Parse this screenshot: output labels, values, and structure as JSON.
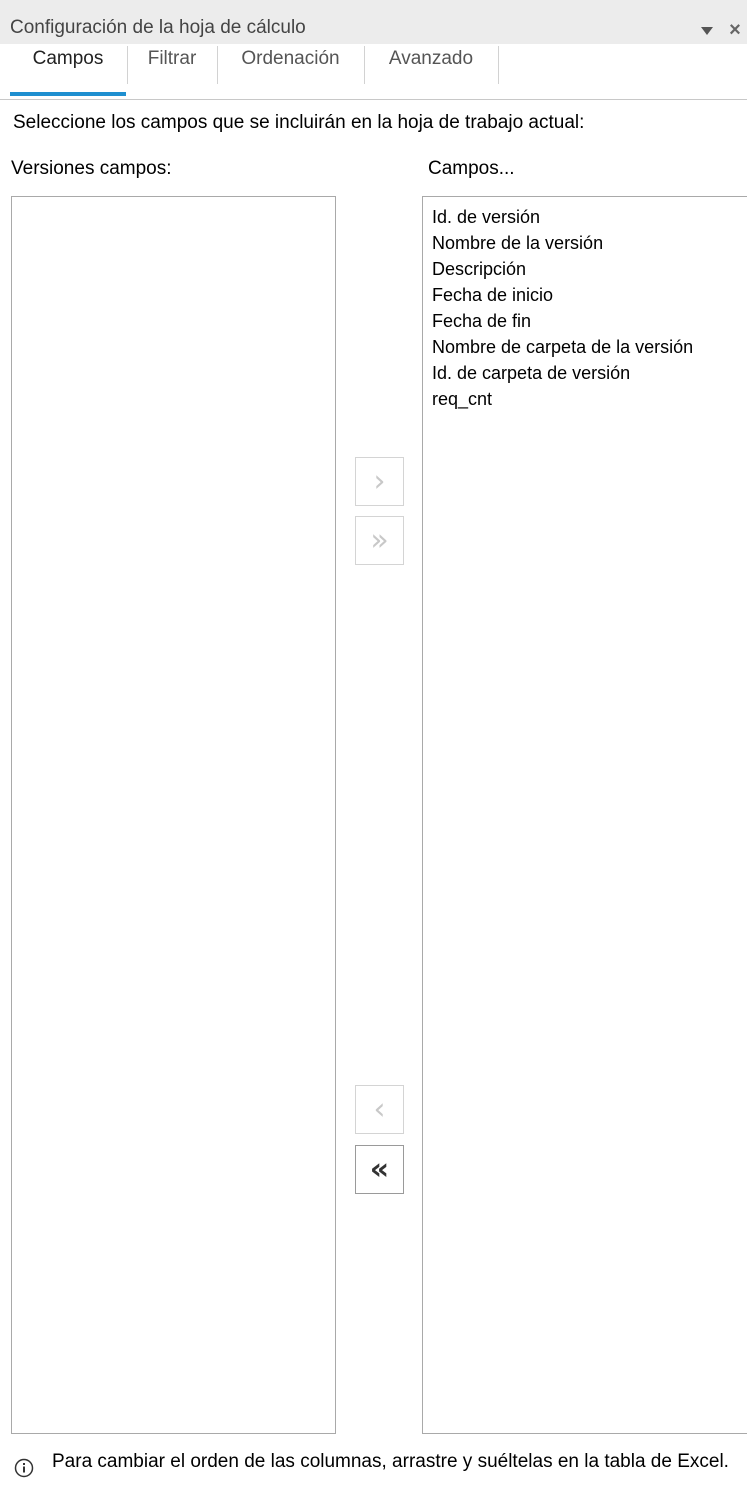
{
  "pane": {
    "title": "Configuración de la hoja de cálculo",
    "menu_icon": "dropdown-arrow-icon",
    "close_icon": "close-icon",
    "close_glyph": "×"
  },
  "tabs": [
    {
      "label": "Campos",
      "active": true
    },
    {
      "label": "Filtrar",
      "active": false
    },
    {
      "label": "Ordenación",
      "active": false
    },
    {
      "label": "Avanzado",
      "active": false
    }
  ],
  "instruction": "Seleccione los campos que se incluirán en la hoja de trabajo actual:",
  "available": {
    "label": "Versiones campos:",
    "items": []
  },
  "selected": {
    "label": "Campos...",
    "items": [
      "Id. de versión",
      "Nombre de la versión",
      "Descripción",
      "Fecha de inicio",
      "Fecha de fin",
      "Nombre de carpeta de la versión",
      "Id. de carpeta de versión",
      "req_cnt"
    ]
  },
  "buttons": {
    "add": {
      "glyph": "›",
      "enabled": false
    },
    "add_all": {
      "glyph": "»",
      "enabled": false
    },
    "remove": {
      "glyph": "‹",
      "enabled": false
    },
    "remove_all": {
      "glyph": "«",
      "enabled": true
    }
  },
  "footer": {
    "icon": "info-icon",
    "text": "Para cambiar el orden de las columnas, arrastre y suéltelas en la tabla de Excel."
  },
  "colors": {
    "accent": "#1e8fd0",
    "title_bar": "#ececec",
    "border": "#a9a9a9"
  }
}
